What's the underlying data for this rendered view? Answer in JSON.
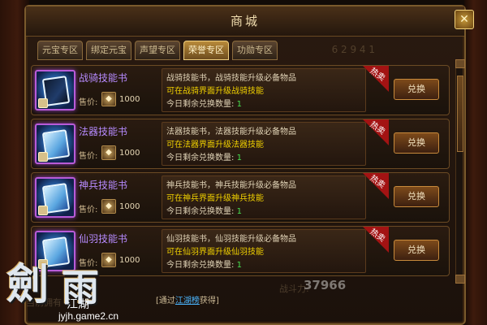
{
  "window": {
    "title": "商城",
    "close_label": "✕"
  },
  "tabs": [
    {
      "label": "元宝专区",
      "active": false
    },
    {
      "label": "绑定元宝",
      "active": false
    },
    {
      "label": "声望专区",
      "active": false
    },
    {
      "label": "荣誉专区",
      "active": true
    },
    {
      "label": "功勋专区",
      "active": false
    }
  ],
  "currency_hint": "6 2 9 4 1",
  "items": [
    {
      "name": "战骑技能书",
      "price_label": "售价:",
      "price_value": "1000",
      "desc_line1": "战骑技能书，战骑技能升级必备物品",
      "desc_line2": "可在战骑界面升级战骑技能",
      "desc_line3_prefix": "今日剩余兑换数量:",
      "desc_line3_value": "1",
      "ribbon": "热卖",
      "button": "兑换"
    },
    {
      "name": "法器技能书",
      "price_label": "售价:",
      "price_value": "1000",
      "desc_line1": "法器技能书，法器技能升级必备物品",
      "desc_line2": "可在法器界面升级法器技能",
      "desc_line3_prefix": "今日剩余兑换数量:",
      "desc_line3_value": "1",
      "ribbon": "热卖",
      "button": "兑换"
    },
    {
      "name": "神兵技能书",
      "price_label": "售价:",
      "price_value": "1000",
      "desc_line1": "神兵技能书，神兵技能升级必备物品",
      "desc_line2": "可在神兵界面升级神兵技能",
      "desc_line3_prefix": "今日剩余兑换数量:",
      "desc_line3_value": "1",
      "ribbon": "热卖",
      "button": "兑换"
    },
    {
      "name": "仙羽技能书",
      "price_label": "售价:",
      "price_value": "1000",
      "desc_line1": "仙羽技能书，仙羽技能升级必备物品",
      "desc_line2": "可在仙羽界面升级仙羽技能",
      "desc_line3_prefix": "今日剩余兑换数量:",
      "desc_line3_value": "1",
      "ribbon": "热卖",
      "button": "兑换"
    }
  ],
  "footer": {
    "bracket_open": "[",
    "prefix": "通过",
    "link": "江湖榜",
    "suffix": "获得]"
  },
  "bg": {
    "left_text": "当前拥有",
    "score_label": "战斗力:",
    "score_value": "37966"
  },
  "logo": {
    "char1": "劍",
    "char2": "雨",
    "subtitle": "江湖",
    "domain": "jyjh.game2.cn"
  }
}
